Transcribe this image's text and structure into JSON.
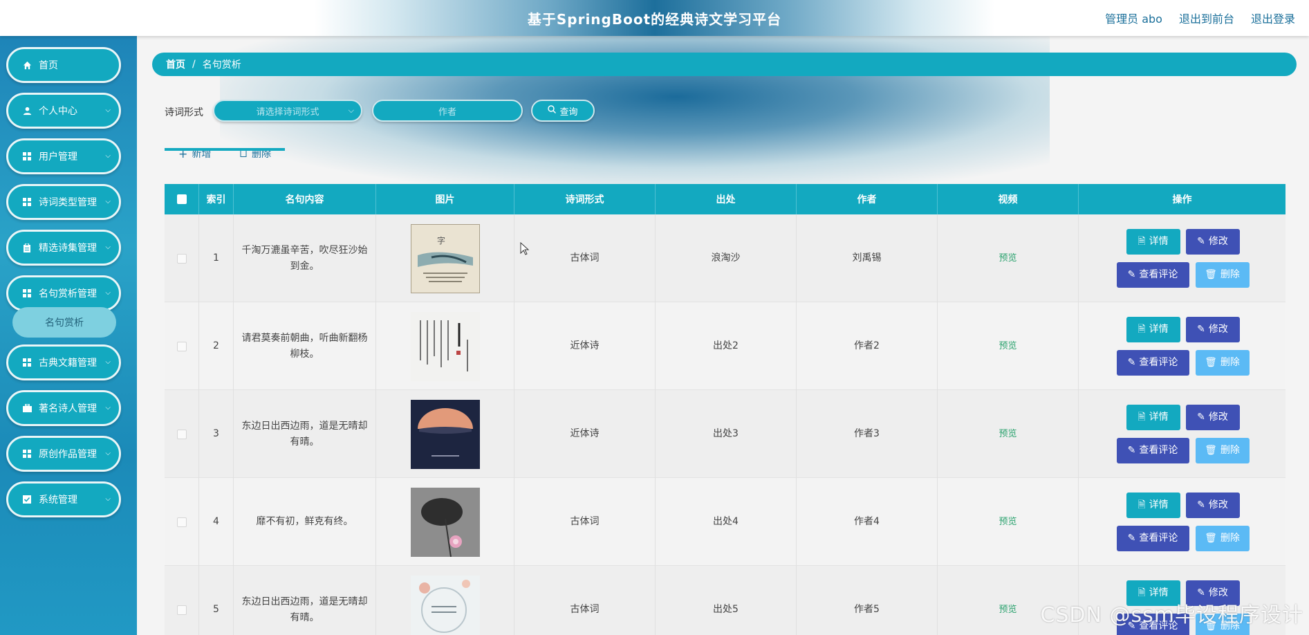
{
  "header": {
    "title": "基于SpringBoot的经典诗文学习平台",
    "user_label": "管理员 abo",
    "front_label": "退出到前台",
    "logout_label": "退出登录"
  },
  "sidebar": {
    "items": [
      {
        "label": "首页",
        "icon": "home-icon"
      },
      {
        "label": "个人中心",
        "icon": "user-icon"
      },
      {
        "label": "用户管理",
        "icon": "grid-icon"
      },
      {
        "label": "诗词类型管理",
        "icon": "grid-icon"
      },
      {
        "label": "精选诗集管理",
        "icon": "clipboard-icon"
      },
      {
        "label": "名句赏析管理",
        "icon": "grid-icon"
      },
      {
        "label": "古典文籍管理",
        "icon": "grid-icon"
      },
      {
        "label": "著名诗人管理",
        "icon": "briefcase-icon"
      },
      {
        "label": "原创作品管理",
        "icon": "grid-icon"
      },
      {
        "label": "系统管理",
        "icon": "checkbox-icon"
      }
    ],
    "active_sub": "名句赏析"
  },
  "breadcrumb": {
    "home": "首页",
    "sep": "/",
    "current": "名句赏析"
  },
  "filters": {
    "form_label": "诗词形式",
    "form_placeholder": "请选择诗词形式",
    "author_placeholder": "作者",
    "query_label": "查询"
  },
  "actions": {
    "add_label": "新增",
    "delete_label": "删除"
  },
  "table": {
    "headers": [
      "索引",
      "名句内容",
      "图片",
      "诗词形式",
      "出处",
      "作者",
      "视频",
      "操作"
    ],
    "rows": [
      {
        "index": "1",
        "content": "千淘万漉虽辛苦，吹尽狂沙始到金。",
        "form": "古体词",
        "source": "浪淘沙",
        "author": "刘禹锡",
        "video": "预览"
      },
      {
        "index": "2",
        "content": "请君莫奏前朝曲，听曲新翻杨柳枝。",
        "form": "近体诗",
        "source": "出处2",
        "author": "作者2",
        "video": "预览"
      },
      {
        "index": "3",
        "content": "东边日出西边雨，道是无晴却有晴。",
        "form": "近体诗",
        "source": "出处3",
        "author": "作者3",
        "video": "预览"
      },
      {
        "index": "4",
        "content": "靡不有初，鲜克有终。",
        "form": "古体词",
        "source": "出处4",
        "author": "作者4",
        "video": "预览"
      },
      {
        "index": "5",
        "content": "东边日出西边雨，道是无晴却有晴。",
        "form": "古体词",
        "source": "出处5",
        "author": "作者5",
        "video": "预览"
      }
    ],
    "op_labels": {
      "detail": "详情",
      "edit": "修改",
      "comments": "查看评论",
      "delete": "删除"
    }
  },
  "watermark": "CSDN @ssm毕设程序设计",
  "colors": {
    "accent": "#13a9c0",
    "indigo": "#3f51b5",
    "light_blue": "#5bbaf5",
    "preview_green": "#2ba26e"
  }
}
